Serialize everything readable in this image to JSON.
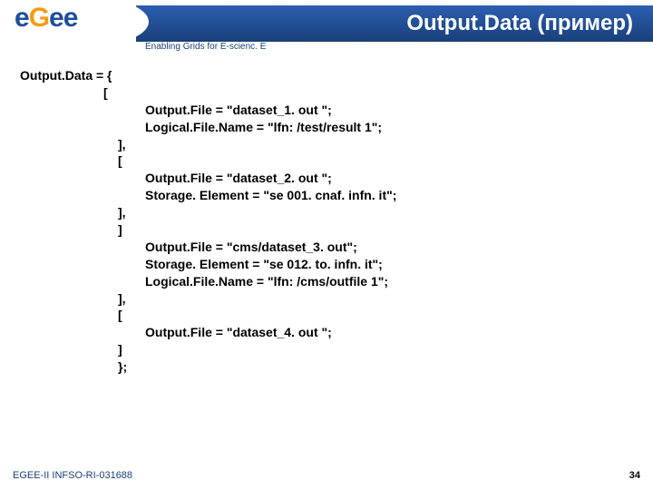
{
  "logo": {
    "e1": "e",
    "g": "G",
    "e2": "e",
    "e3": "e"
  },
  "tagline": "Enabling Grids for E-scienc. E",
  "title": "Output.Data (пример)",
  "code": {
    "l1": "Output.Data = {",
    "l2": "[",
    "l3": "Output.File = \"dataset_1. out \";",
    "l4": "Logical.File.Name = \"lfn: /test/result 1\";",
    "l5": "],",
    "l6": "[",
    "l7": "Output.File = \"dataset_2. out \";",
    "l8": "Storage. Element = \"se 001. cnaf. infn. it\";",
    "l9": "],",
    "l10": "]",
    "l11": "Output.File = \"cms/dataset_3. out\";",
    "l12": "Storage. Element = \"se 012. to. infn. it\";",
    "l13": "Logical.File.Name = \"lfn: /cms/outfile 1\";",
    "l14": "],",
    "l15": "[",
    "l16": "Output.File = \"dataset_4. out \";",
    "l17": "]",
    "l18": "};"
  },
  "footer": {
    "left": "EGEE-II INFSO-RI-031688",
    "right": "34"
  }
}
